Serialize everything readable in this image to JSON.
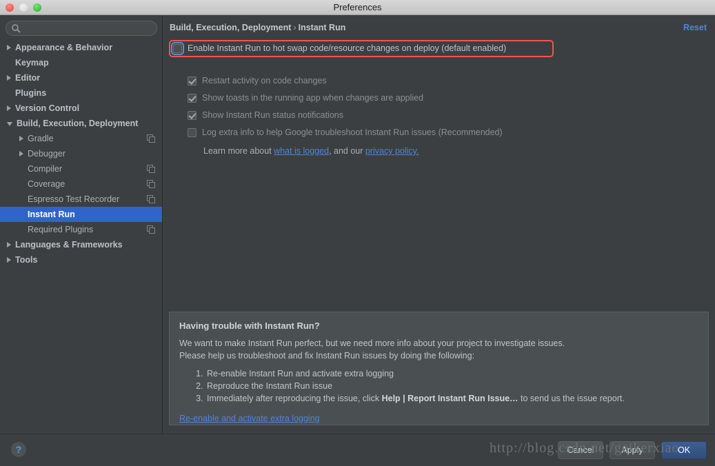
{
  "window": {
    "title": "Preferences",
    "traffic_lights": [
      "close",
      "minimize",
      "maximize"
    ]
  },
  "sidebar": {
    "search": {
      "value": "",
      "placeholder": ""
    },
    "items": [
      {
        "label": "Appearance & Behavior",
        "arrow": "right",
        "indent": 0,
        "bold": true,
        "selected": false,
        "copy_icon": false
      },
      {
        "label": "Keymap",
        "arrow": "none",
        "indent": 0,
        "bold": true,
        "selected": false,
        "copy_icon": false
      },
      {
        "label": "Editor",
        "arrow": "right",
        "indent": 0,
        "bold": true,
        "selected": false,
        "copy_icon": false
      },
      {
        "label": "Plugins",
        "arrow": "none",
        "indent": 0,
        "bold": true,
        "selected": false,
        "copy_icon": false
      },
      {
        "label": "Version Control",
        "arrow": "right",
        "indent": 0,
        "bold": true,
        "selected": false,
        "copy_icon": false
      },
      {
        "label": "Build, Execution, Deployment",
        "arrow": "down",
        "indent": 0,
        "bold": true,
        "selected": false,
        "copy_icon": false
      },
      {
        "label": "Gradle",
        "arrow": "right",
        "indent": 1,
        "bold": false,
        "selected": false,
        "copy_icon": true
      },
      {
        "label": "Debugger",
        "arrow": "right",
        "indent": 1,
        "bold": false,
        "selected": false,
        "copy_icon": false
      },
      {
        "label": "Compiler",
        "arrow": "none",
        "indent": 1,
        "bold": false,
        "selected": false,
        "copy_icon": true
      },
      {
        "label": "Coverage",
        "arrow": "none",
        "indent": 1,
        "bold": false,
        "selected": false,
        "copy_icon": true
      },
      {
        "label": "Espresso Test Recorder",
        "arrow": "none",
        "indent": 1,
        "bold": false,
        "selected": false,
        "copy_icon": true
      },
      {
        "label": "Instant Run",
        "arrow": "none",
        "indent": 1,
        "bold": false,
        "selected": true,
        "copy_icon": false
      },
      {
        "label": "Required Plugins",
        "arrow": "none",
        "indent": 1,
        "bold": false,
        "selected": false,
        "copy_icon": true
      },
      {
        "label": "Languages & Frameworks",
        "arrow": "right",
        "indent": 0,
        "bold": true,
        "selected": false,
        "copy_icon": false
      },
      {
        "label": "Tools",
        "arrow": "right",
        "indent": 0,
        "bold": true,
        "selected": false,
        "copy_icon": false
      }
    ]
  },
  "content": {
    "breadcrumb_parent": "Build, Execution, Deployment",
    "breadcrumb_separator": "›",
    "breadcrumb_current": "Instant Run",
    "reset_label": "Reset",
    "highlight_color": "#f1554c",
    "accent_color": "#4d86d6",
    "selection_color": "#2f65ca",
    "checkboxes": [
      {
        "label": "Enable Instant Run to hot swap code/resource changes on deploy (default enabled)",
        "checked": false,
        "enabled": true,
        "focused": true,
        "highlighted": true
      },
      {
        "label": "Restart activity on code changes",
        "checked": true,
        "enabled": false,
        "focused": false,
        "highlighted": false
      },
      {
        "label": "Show toasts in the running app when changes are applied",
        "checked": true,
        "enabled": false,
        "focused": false,
        "highlighted": false
      },
      {
        "label": "Show Instant Run status notifications",
        "checked": true,
        "enabled": false,
        "focused": false,
        "highlighted": false
      },
      {
        "label": "Log extra info to help Google troubleshoot Instant Run issues (Recommended)",
        "checked": false,
        "enabled": false,
        "focused": false,
        "highlighted": false
      }
    ],
    "learn_more": {
      "prefix": "Learn more about ",
      "link1": "what is logged",
      "middle": ", and our ",
      "link2": "privacy policy.",
      "suffix": ""
    },
    "trouble_panel": {
      "heading": "Having trouble with Instant Run?",
      "line1": "We want to make Instant Run perfect, but we need more info about your project to investigate issues.",
      "line2": "Please help us troubleshoot and fix Instant Run issues by doing the following:",
      "steps": [
        {
          "text": "Re-enable Instant Run and activate extra logging"
        },
        {
          "text": "Reproduce the Instant Run issue"
        }
      ],
      "step3_prefix": "Immediately after reproducing the issue, click ",
      "step3_bold": "Help | Report Instant Run Issue…",
      "step3_suffix": " to send us the issue report.",
      "link": "Re-enable and activate extra logging"
    }
  },
  "footer": {
    "help_label": "?",
    "watermark": "http://blog.csdn.net/geikerxiao",
    "buttons": [
      {
        "label": "Cancel",
        "primary": false
      },
      {
        "label": "Apply",
        "primary": false
      },
      {
        "label": "OK",
        "primary": true
      }
    ]
  }
}
